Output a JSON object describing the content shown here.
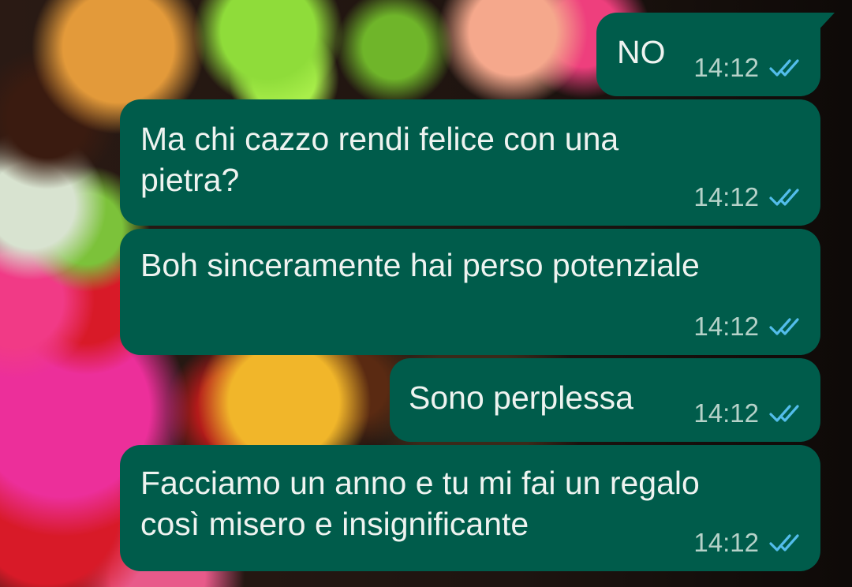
{
  "chat": {
    "bubble_color": "#005c4b",
    "text_color": "#eef3f0",
    "tick_color": "#53bdeb",
    "messages": [
      {
        "text": "NO",
        "time": "14:12",
        "status": "read"
      },
      {
        "text": "Ma chi cazzo rendi felice con una pietra?",
        "time": "14:12",
        "status": "read"
      },
      {
        "text": "Boh sinceramente hai perso potenziale",
        "time": "14:12",
        "status": "read"
      },
      {
        "text": "Sono perplessa",
        "time": "14:12",
        "status": "read"
      },
      {
        "text": "Facciamo un anno e tu mi fai un regalo così misero e insignificante",
        "time": "14:12",
        "status": "read"
      }
    ]
  }
}
